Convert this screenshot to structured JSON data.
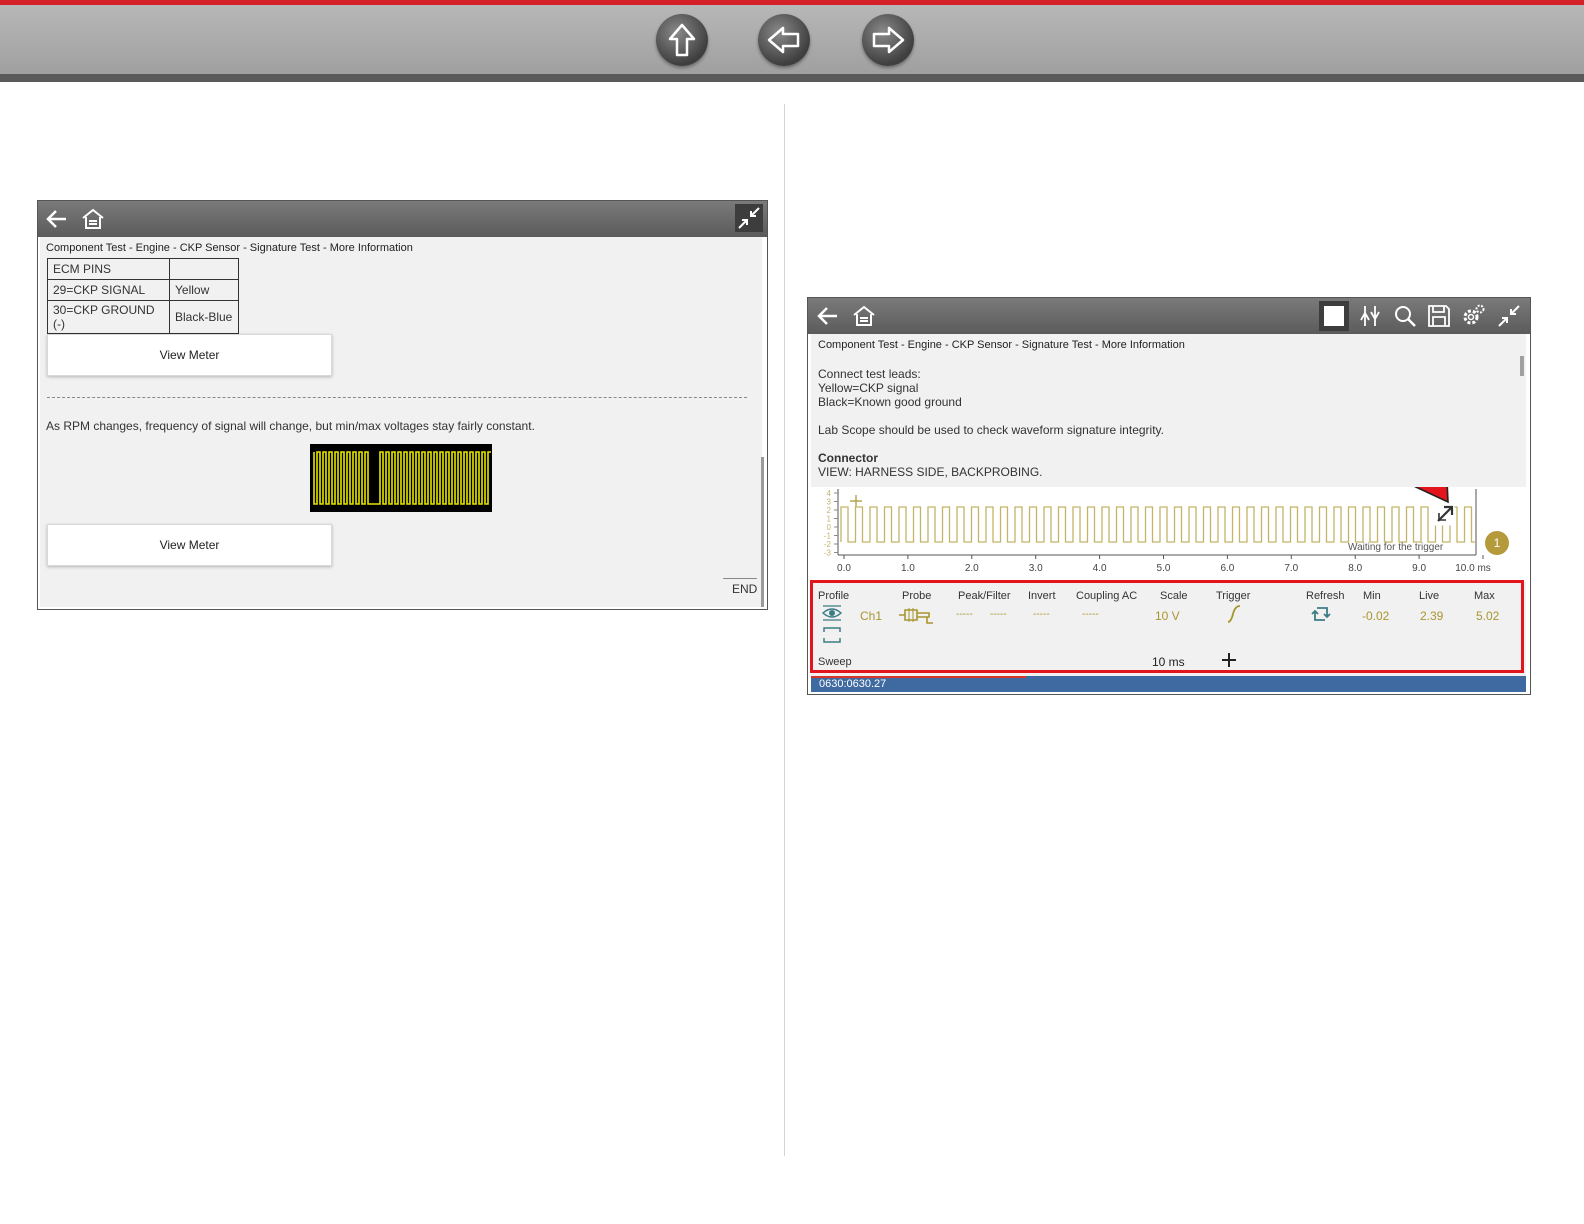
{
  "nav": {
    "up_icon": "up-arrow-icon",
    "back_icon": "left-arrow-icon",
    "forward_icon": "right-arrow-icon",
    "accent": "#d52027"
  },
  "left_screen": {
    "breadcrumb": "Component Test - Engine - CKP Sensor - Signature Test - More Information",
    "table": {
      "rows": [
        [
          "ECM PINS",
          ""
        ],
        [
          "29=CKP SIGNAL",
          "Yellow"
        ],
        [
          "30=CKP GROUND (-)",
          "Black-Blue"
        ]
      ]
    },
    "view_meter_1": "View Meter",
    "description": "As RPM changes, frequency of signal will change, but min/max voltages stay fairly constant.",
    "view_meter_2": "View Meter",
    "end_label": "END"
  },
  "right_screen": {
    "breadcrumb": "Component Test - Engine - CKP Sensor - Signature Test - More Information",
    "leads_title": "Connect test leads:",
    "lead_yellow": "Yellow=CKP signal",
    "lead_black": "Black=Known good ground",
    "lab_scope_note": "Lab Scope should be used to check waveform signature integrity.",
    "connector_title": "Connector",
    "connector_view": "VIEW: HARNESS SIDE, BACKPROBING.",
    "scope": {
      "x_ticks": [
        "0.0",
        "1.0",
        "2.0",
        "3.0",
        "4.0",
        "5.0",
        "6.0",
        "7.0",
        "8.0",
        "9.0",
        "10.0 ms"
      ],
      "y_ticks": [
        "4",
        "3",
        "2",
        "1",
        "0",
        "-1",
        "-2",
        "-3"
      ],
      "status": "Waiting for the trigger",
      "channel_marker": "1",
      "trace_color": "#a8962e"
    },
    "controls": {
      "headers": {
        "profile": "Profile",
        "probe": "Probe",
        "peak_filter": "Peak/Filter",
        "invert": "Invert",
        "coupling": "Coupling AC",
        "scale": "Scale",
        "trigger": "Trigger",
        "refresh": "Refresh",
        "min": "Min",
        "live": "Live",
        "max": "Max"
      },
      "channel": "Ch1",
      "peak_a": "-----",
      "peak_b": "-----",
      "invert_val": "-----",
      "coupling_val": "-----",
      "scale_val": "10 V",
      "min_val": "-0.02",
      "live_val": "2.39",
      "max_val": "5.02",
      "sweep_label": "Sweep",
      "sweep_val": "10 ms",
      "highlight_color": "#e4141c"
    },
    "status_bar": "0630:0630.27"
  }
}
